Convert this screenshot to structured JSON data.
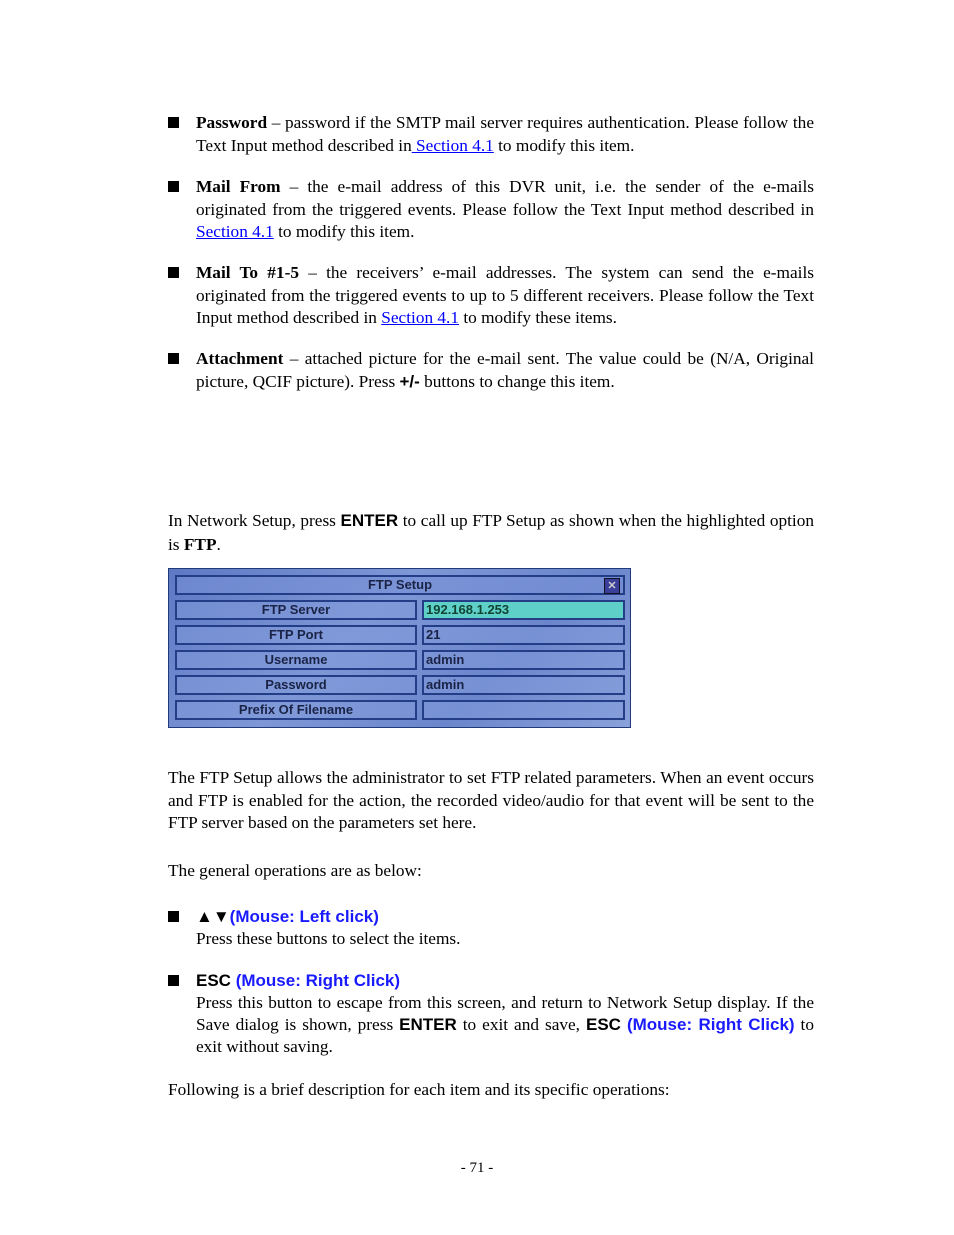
{
  "bullets_top": [
    {
      "segs": [
        [
          "b",
          "Password"
        ],
        [
          "t",
          " – password if the SMTP mail server requires authentication.   Please follow the Text Input method described in"
        ],
        [
          "l",
          " Section 4.1"
        ],
        [
          "t",
          " to modify this item."
        ]
      ]
    },
    {
      "segs": [
        [
          "b",
          "Mail From"
        ],
        [
          "t",
          " – the e-mail address of this DVR unit, i.e. the sender of the e-mails originated from the triggered events.   Please follow the Text Input method described in "
        ],
        [
          "l",
          "Section 4.1"
        ],
        [
          "t",
          " to modify this item."
        ]
      ]
    },
    {
      "segs": [
        [
          "b",
          "Mail To #1-5"
        ],
        [
          "t",
          " – the receivers’ e-mail addresses.   The system can send the e-mails originated from the triggered events to up to 5 different receivers.   Please follow the Text Input method described in "
        ],
        [
          "l",
          "Section 4.1"
        ],
        [
          "t",
          " to modify these items."
        ]
      ]
    },
    {
      "segs": [
        [
          "b",
          "Attachment"
        ],
        [
          "t",
          " – attached picture for the e-mail sent.   The value could be (N/A, Original picture, QCIF picture).   Press "
        ],
        [
          "sb",
          "+/-"
        ],
        [
          "t",
          " buttons to change this item."
        ]
      ]
    }
  ],
  "intro": {
    "segs": [
      [
        "t",
        "In Network Setup, press "
      ],
      [
        "sb",
        "ENTER"
      ],
      [
        "t",
        " to call up FTP Setup as shown when the highlighted option is "
      ],
      [
        "b",
        "FTP"
      ],
      [
        "t",
        "."
      ]
    ]
  },
  "ftp_setup": {
    "title": "FTP Setup",
    "close_icon": "close-x-icon",
    "rows": [
      {
        "label": "FTP Server",
        "value": "192.168.1.253",
        "highlighted": true
      },
      {
        "label": "FTP Port",
        "value": "21"
      },
      {
        "label": "Username",
        "value": "admin"
      },
      {
        "label": "Password",
        "value": "admin"
      },
      {
        "label": "Prefix Of Filename",
        "value": ""
      }
    ]
  },
  "desc": {
    "segs": [
      [
        "t",
        "The FTP Setup allows the administrator to set FTP related parameters.   When an event occurs and FTP is enabled for the action, the recorded video/audio for that event will be sent to the FTP server based on the parameters set here."
      ]
    ]
  },
  "general": {
    "segs": [
      [
        "t",
        "The general operations are as below:"
      ]
    ]
  },
  "bullets_ops": [
    {
      "segs": [
        [
          "sb",
          "▲▼"
        ],
        [
          "bl",
          "(Mouse: Left click)"
        ],
        [
          "br",
          ""
        ],
        [
          "t",
          "Press these buttons to select the items."
        ]
      ]
    },
    {
      "segs": [
        [
          "sb",
          "ESC "
        ],
        [
          "bl",
          "(Mouse: Right Click)"
        ],
        [
          "br",
          ""
        ],
        [
          "t",
          "Press this button to escape from this screen, and return to Network Setup display.   If the Save dialog is shown, press "
        ],
        [
          "sb",
          "ENTER"
        ],
        [
          "t",
          " to exit and save, "
        ],
        [
          "sb",
          "ESC"
        ],
        [
          "t",
          " "
        ],
        [
          "bl",
          "(Mouse: Right Click)"
        ],
        [
          "t",
          " to exit without saving."
        ]
      ]
    }
  ],
  "following": {
    "segs": [
      [
        "t",
        "Following is a brief description for each item and its specific operations:"
      ]
    ]
  },
  "page_number": "- 71 -",
  "colors": {
    "link": "#0000ff",
    "mouse_hint": "#1a1aff",
    "highlight": "#5fd0c8"
  }
}
